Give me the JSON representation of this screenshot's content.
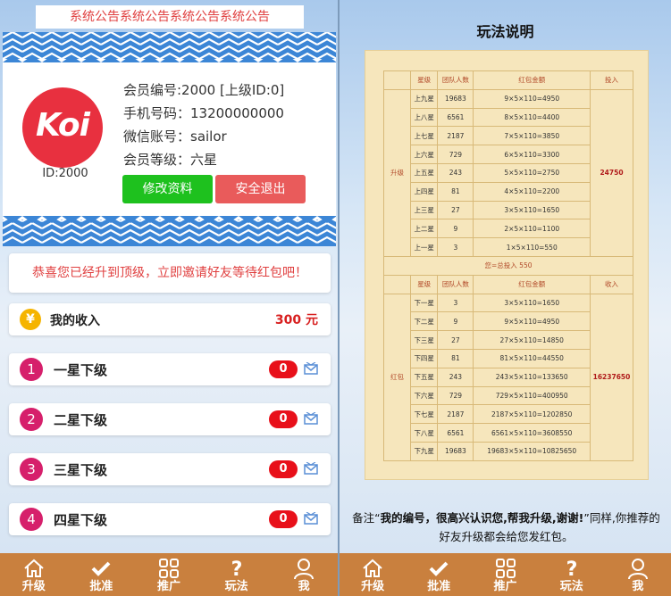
{
  "left": {
    "notice": "系统公告系统公告系统公告系统公告",
    "profile": {
      "logo_text": "Koi",
      "id_label": "ID:2000",
      "member_no": "会员编号:2000 [上级ID:0]",
      "phone": "手机号码：13200000000",
      "wechat": "微信账号：sailor",
      "level": "会员等级：六星",
      "edit_button": "修改资料",
      "logout_button": "安全退出"
    },
    "congrats": "恭喜您已经升到顶级，立即邀请好友等待红包吧！",
    "income": {
      "icon": "¥",
      "label": "我的收入",
      "value": "300 元"
    },
    "levels": [
      {
        "num": "1",
        "label": "一星下级",
        "count": "0"
      },
      {
        "num": "2",
        "label": "二星下级",
        "count": "0"
      },
      {
        "num": "3",
        "label": "三星下级",
        "count": "0"
      },
      {
        "num": "4",
        "label": "四星下级",
        "count": "0"
      }
    ],
    "nav": [
      "升级",
      "批准",
      "推广",
      "玩法",
      "我"
    ]
  },
  "right": {
    "title": "玩法说明",
    "table": {
      "up_header": [
        "星级",
        "团队人数",
        "红包金额",
        "投入"
      ],
      "up_section": "升级",
      "up_rows": [
        [
          "上九星",
          "19683",
          "9×5×110=4950"
        ],
        [
          "上八星",
          "6561",
          "8×5×110=4400"
        ],
        [
          "上七星",
          "2187",
          "7×5×110=3850"
        ],
        [
          "上六星",
          "729",
          "6×5×110=3300"
        ],
        [
          "上五星",
          "243",
          "5×5×110=2750"
        ],
        [
          "上四星",
          "81",
          "4×5×110=2200"
        ],
        [
          "上三星",
          "27",
          "3×5×110=1650"
        ],
        [
          "上二星",
          "9",
          "2×5×110=1100"
        ],
        [
          "上一星",
          "3",
          "1×5×110=550"
        ]
      ],
      "up_total": "24750",
      "middle": "您=总投入 550",
      "down_header": [
        "星级",
        "团队人数",
        "红包金额",
        "收入"
      ],
      "down_section": "红包",
      "down_rows": [
        [
          "下一星",
          "3",
          "3×5×110=1650"
        ],
        [
          "下二星",
          "9",
          "9×5×110=4950"
        ],
        [
          "下三星",
          "27",
          "27×5×110=14850"
        ],
        [
          "下四星",
          "81",
          "81×5×110=44550"
        ],
        [
          "下五星",
          "243",
          "243×5×110=133650"
        ],
        [
          "下六星",
          "729",
          "729×5×110=400950"
        ],
        [
          "下七星",
          "2187",
          "2187×5×110=1202850"
        ],
        [
          "下八星",
          "6561",
          "6561×5×110=3608550"
        ],
        [
          "下九星",
          "19683",
          "19683×5×110=10825650"
        ]
      ],
      "down_total": "16237650"
    },
    "note_prefix": "备注“",
    "note_bold": "我的编号，很高兴认识您,帮我升级,谢谢!",
    "note_suffix": "”同样,你推荐的好友升级都会给您发红包。",
    "nav": [
      "升级",
      "批准",
      "推广",
      "玩法",
      "我"
    ]
  },
  "colors": {
    "nav_bg": "#c9803e",
    "accent_red": "#e8303f",
    "edit_green": "#1ec11e",
    "logout_red": "#e95b5b",
    "level_badge": "#d61f6b",
    "count_badge": "#e8101a"
  },
  "icons": [
    "home-icon",
    "check-icon",
    "grid-icon",
    "question-icon",
    "user-icon",
    "mail-icon",
    "yen-icon"
  ]
}
